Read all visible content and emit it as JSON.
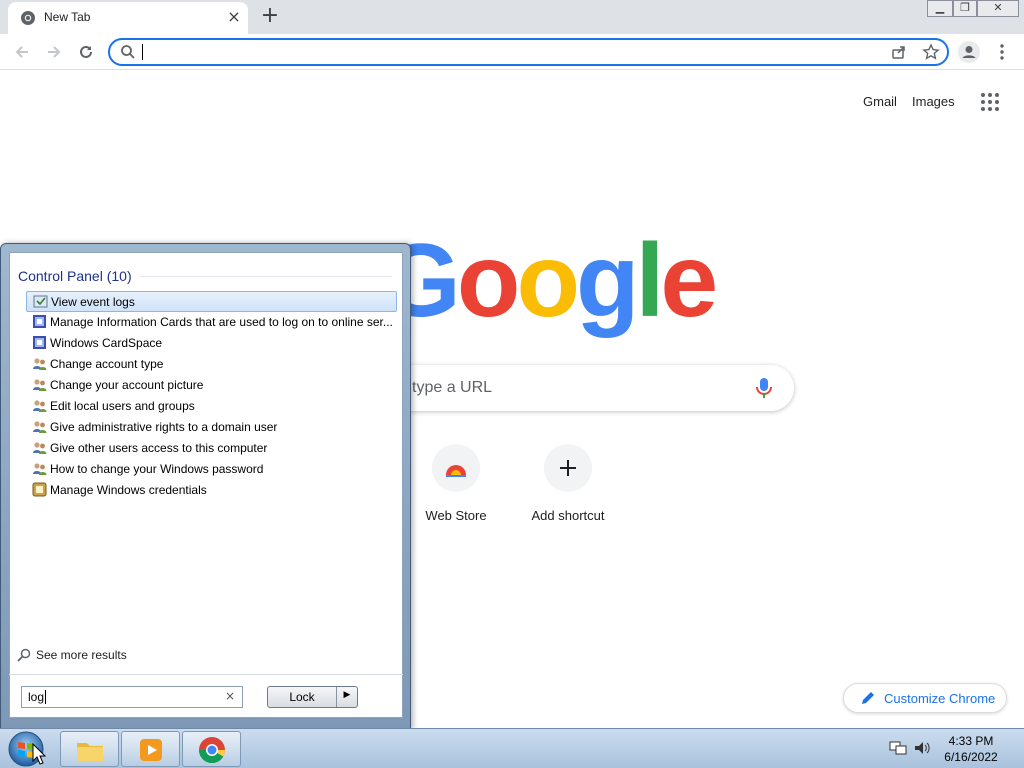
{
  "browser": {
    "tab_title": "New Tab",
    "close_tab": "×",
    "new_tab": "+",
    "window_controls": {
      "minimize": "▁",
      "restore": "❐",
      "close": "✕"
    },
    "address_value": ""
  },
  "ntp": {
    "gmail": "Gmail",
    "images": "Images",
    "logo_letters": [
      "G",
      "o",
      "o",
      "g",
      "l",
      "e"
    ],
    "logo_colors": [
      "#4285f4",
      "#ea4335",
      "#fbbc05",
      "#4285f4",
      "#34a853",
      "#ea4335"
    ],
    "search_placeholder": "type a URL",
    "shortcuts": [
      {
        "label": "Web Store",
        "icon": "web-store-icon"
      },
      {
        "label": "Add shortcut",
        "icon": "plus-icon"
      }
    ],
    "customize": "Customize Chrome"
  },
  "start_menu": {
    "header": "Control Panel (10)",
    "results": [
      {
        "label": "View event logs",
        "icon": "event-viewer-icon",
        "selected": true
      },
      {
        "label": "Manage Information Cards that are used to log on to online ser...",
        "icon": "cardspace-icon"
      },
      {
        "label": "Windows CardSpace",
        "icon": "cardspace-icon"
      },
      {
        "label": "Change account type",
        "icon": "users-icon"
      },
      {
        "label": "Change your account picture",
        "icon": "users-icon"
      },
      {
        "label": "Edit local users and groups",
        "icon": "users-icon"
      },
      {
        "label": "Give administrative rights to a domain user",
        "icon": "users-icon"
      },
      {
        "label": "Give other users access to this computer",
        "icon": "users-icon"
      },
      {
        "label": "How to change your Windows password",
        "icon": "users-icon"
      },
      {
        "label": "Manage Windows credentials",
        "icon": "credential-manager-icon"
      }
    ],
    "see_more": "See more results",
    "search_value": "log",
    "clear": "×",
    "lock": "Lock",
    "lock_arrow": "▶"
  },
  "taskbar": {
    "time": "4:33 PM",
    "date": "6/16/2022"
  }
}
